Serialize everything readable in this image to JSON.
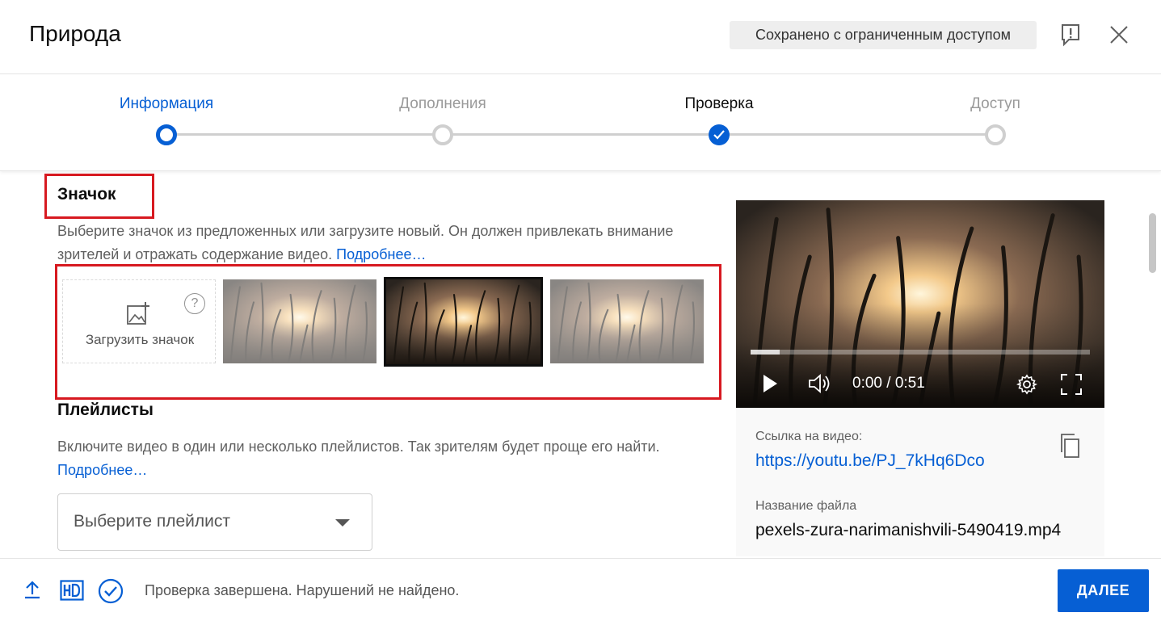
{
  "header": {
    "title": "Природа",
    "saved_status": "Сохранено с ограниченным доступом"
  },
  "stepper": {
    "steps": [
      {
        "label": "Информация",
        "state": "current"
      },
      {
        "label": "Дополнения",
        "state": "pending"
      },
      {
        "label": "Проверка",
        "state": "done"
      },
      {
        "label": "Доступ",
        "state": "pending"
      }
    ]
  },
  "thumbnail": {
    "title": "Значок",
    "description": "Выберите значок из предложенных или загрузите новый. Он должен привлекать внимание зрителей и отражать содержание видео.",
    "more_link": "Подробнее…",
    "upload_label": "Загрузить значок",
    "help_glyph": "?",
    "selected_index": 1
  },
  "playlists": {
    "title": "Плейлисты",
    "description": "Включите видео в один или несколько плейлистов. Так зрителям будет проще его найти.",
    "more_link": "Подробнее…",
    "select_placeholder": "Выберите плейлист"
  },
  "video": {
    "time": "0:00 / 0:51",
    "progress_fraction": 0.085,
    "link_label": "Ссылка на видео:",
    "link_url": "https://youtu.be/PJ_7kHq6Dco",
    "file_label": "Название файла",
    "file_name": "pexels-zura-narimanishvili-5490419.mp4"
  },
  "footer": {
    "status": "Проверка завершена. Нарушений не найдено.",
    "next_button": "ДАЛЕЕ"
  },
  "colors": {
    "accent": "#065fd4",
    "annotation_red": "#d71920"
  }
}
